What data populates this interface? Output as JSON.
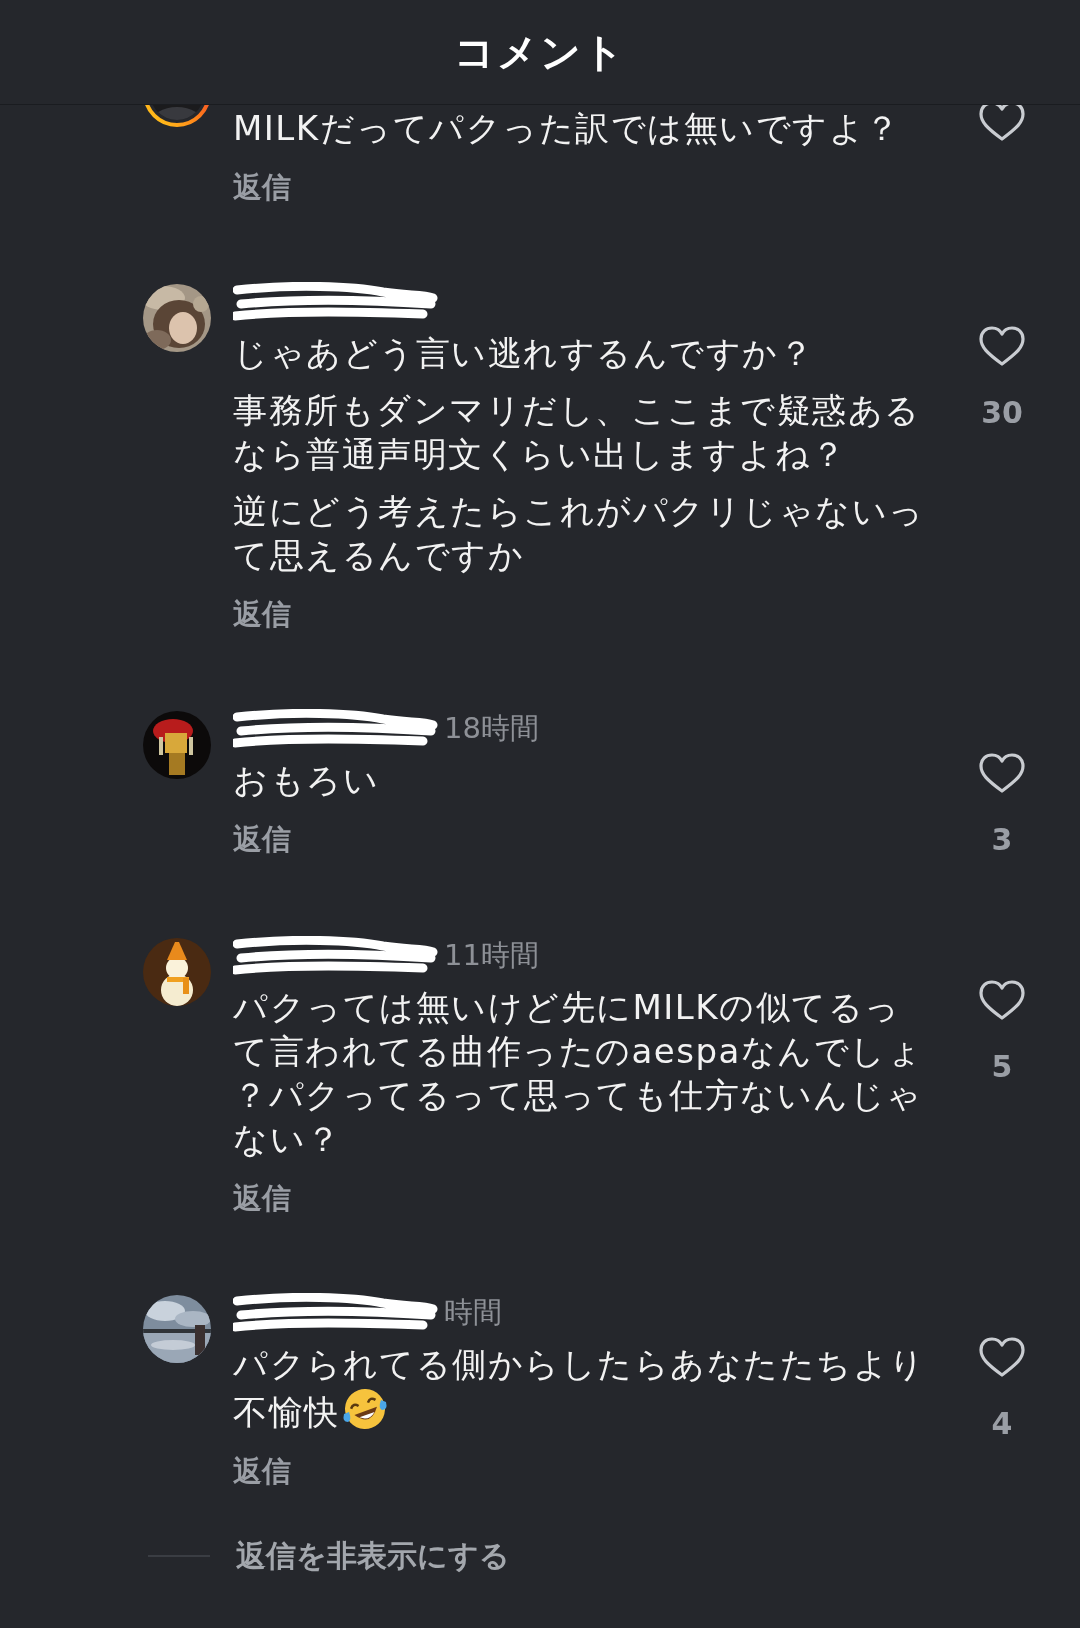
{
  "header": {
    "title": "コメント"
  },
  "comments": [
    {
      "story_ring": true,
      "paragraphs": [
        {
          "text": "MILKだってパクった訳では無いですよ？"
        }
      ],
      "reply": "返信",
      "liked": false
    },
    {
      "story_ring": false,
      "redacted_name": true,
      "paragraphs": [
        {
          "text": "じゃあどう言い逃れするんですか？"
        },
        {
          "text": "事務所もダンマリだし、ここまで疑惑あるなら普通声明文くらい出しますよね？"
        },
        {
          "text": "逆にどう考えたらこれがパクリじゃないって思えるんですか"
        }
      ],
      "reply": "返信",
      "liked": false,
      "likes": "30"
    },
    {
      "story_ring": false,
      "redacted_name": true,
      "time": "18時間",
      "paragraphs": [
        {
          "text": "おもろい"
        }
      ],
      "reply": "返信",
      "liked": false,
      "likes": "3"
    },
    {
      "story_ring": false,
      "redacted_name": true,
      "time": "11時間",
      "paragraphs": [
        {
          "text": "パクっては無いけど先にMILKの似てるって言われてる曲作ったのaespaなんでしょ？パクってるって思っても仕方ないんじゃない？"
        }
      ],
      "reply": "返信",
      "liked": false,
      "likes": "5"
    },
    {
      "story_ring": false,
      "redacted_name": true,
      "time": "時間",
      "paragraphs": [
        {
          "text": "パクられてる側からしたらあなたたちより不愉快",
          "trailing_icon": true
        }
      ],
      "reply": "返信",
      "liked": false,
      "likes": "4"
    }
  ],
  "hide_replies": "返信を非表示にする"
}
